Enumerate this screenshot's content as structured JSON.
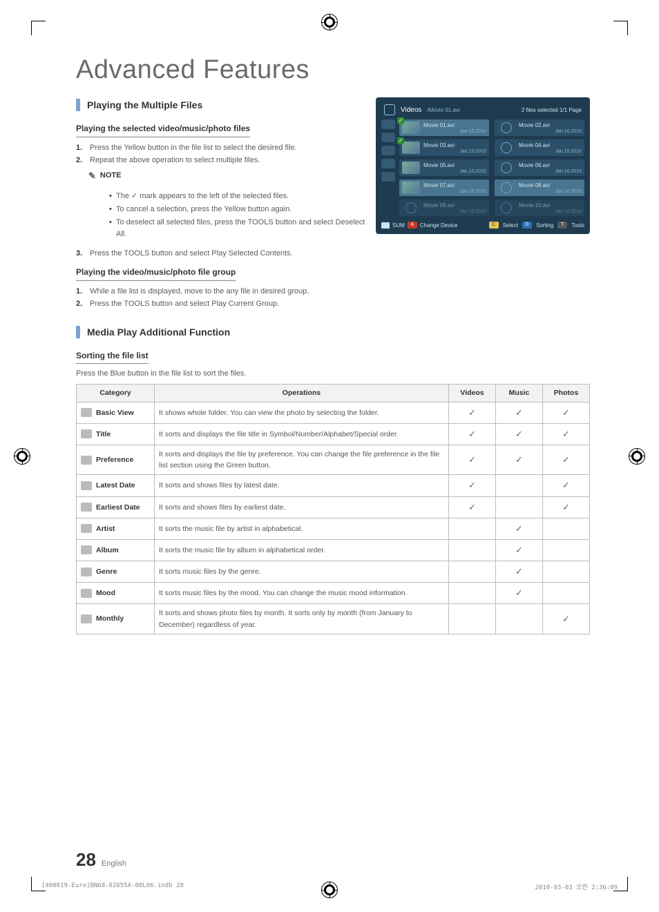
{
  "page_title": "Advanced Features",
  "section1": {
    "heading": "Playing the Multiple Files",
    "sub1": "Playing the selected video/music/photo files",
    "step1_n": "1.",
    "step1": "Press the Yellow button in the file list to select the desired file.",
    "step2_n": "2.",
    "step2": "Repeat the above operation to select multiple files.",
    "note_label": "NOTE",
    "bullets": [
      "The ✓ mark appears to the left of the selected files.",
      "To cancel a selection, press the Yellow button again.",
      "To deselect all selected files, press the TOOLS button and select Deselect All."
    ],
    "step3_n": "3.",
    "step3": "Press the TOOLS button and select Play Selected Contents.",
    "sub2": "Playing the video/music/photo file group",
    "g_step1_n": "1.",
    "g_step1": "While a file list is displayed, move to the any file in desired group.",
    "g_step2_n": "2.",
    "g_step2": "Press the TOOLS button and select Play Current Group."
  },
  "section2": {
    "heading": "Media Play Additional Function",
    "sub": "Sorting the file list",
    "intro": "Press the Blue button in the file list to sort the files."
  },
  "table": {
    "headers": {
      "cat": "Category",
      "ops": "Operations",
      "v": "Videos",
      "m": "Music",
      "p": "Photos"
    },
    "rows": [
      {
        "cat": "Basic View",
        "ops": "It shows whole folder. You can view the photo by selecting the folder.",
        "v": "✓",
        "m": "✓",
        "p": "✓"
      },
      {
        "cat": "Title",
        "ops": "It sorts and displays the file title in Symbol/Number/Alphabet/Special order.",
        "v": "✓",
        "m": "✓",
        "p": "✓"
      },
      {
        "cat": "Preference",
        "ops": "It sorts and displays the file by preference. You can change the file preference in the file list section using the Green button.",
        "v": "✓",
        "m": "✓",
        "p": "✓"
      },
      {
        "cat": "Latest Date",
        "ops": "It sorts and shows files by latest date.",
        "v": "✓",
        "m": "",
        "p": "✓"
      },
      {
        "cat": "Earliest Date",
        "ops": "It sorts and shows files by earliest date.",
        "v": "✓",
        "m": "",
        "p": "✓"
      },
      {
        "cat": "Artist",
        "ops": "It sorts the music file by artist in alphabetical.",
        "v": "",
        "m": "✓",
        "p": ""
      },
      {
        "cat": "Album",
        "ops": "It sorts the music file by album in alphabetical order.",
        "v": "",
        "m": "✓",
        "p": ""
      },
      {
        "cat": "Genre",
        "ops": "It sorts music files by the genre.",
        "v": "",
        "m": "✓",
        "p": ""
      },
      {
        "cat": "Mood",
        "ops": "It sorts music files by the mood. You can change the music mood information.",
        "v": "",
        "m": "✓",
        "p": ""
      },
      {
        "cat": "Monthly",
        "ops": "It sorts and shows photo files by month. It sorts only by month (from January to December) regardless of year.",
        "v": "",
        "m": "",
        "p": "✓"
      }
    ]
  },
  "tv": {
    "label": "Videos",
    "crumb": "/Movie 01.avi",
    "status": "2 files selected   1/1 Page",
    "items": [
      {
        "n": "Movie 01.avi",
        "d": "Jan.10.2010",
        "thumb": true,
        "sel": true,
        "chk": true
      },
      {
        "n": "Movie 02.avi",
        "d": "Jan.10.2010",
        "thumb": false
      },
      {
        "n": "Movie 03.avi",
        "d": "Jan.10.2010",
        "thumb": true,
        "chk": true
      },
      {
        "n": "Movie 04.avi",
        "d": "Jan.10.2010",
        "thumb": false
      },
      {
        "n": "Movie 05.avi",
        "d": "Jan.10.2010",
        "thumb": true
      },
      {
        "n": "Movie 06.avi",
        "d": "Jan.10.2010",
        "thumb": false
      },
      {
        "n": "Movie 07.avi",
        "d": "Jan.10.2010",
        "thumb": true,
        "sel": true
      },
      {
        "n": "Movie 08.avi",
        "d": "Jan.10.2010",
        "thumb": false,
        "sel": true
      },
      {
        "n": "Movie 09.avi",
        "d": "Jan.10.2010",
        "thumb": false,
        "dim": true
      },
      {
        "n": "Movie 10.avi",
        "d": "Jan.10.2010",
        "thumb": false,
        "dim": true
      }
    ],
    "foot": {
      "sum": "SUM",
      "change": "Change Device",
      "select": "Select",
      "sorting": "Sorting",
      "tools": "Tools"
    }
  },
  "page_number": "28",
  "page_lang": "English",
  "footer_left": "[400019-Euro]BN68-02655A-00L06.indb   28",
  "footer_right": "2010-03-03   오전 2:36:09"
}
